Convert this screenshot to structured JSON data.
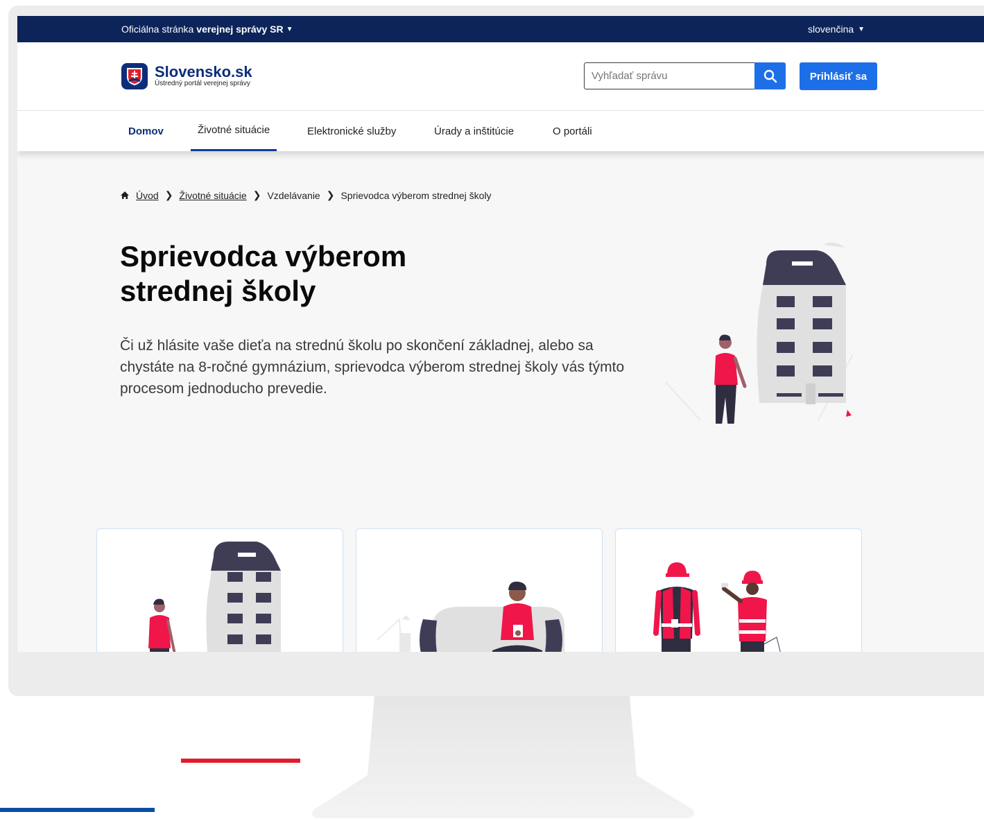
{
  "gov_bar": {
    "official_prefix": "Oficiálna stránka",
    "official_bold": "verejnej správy SR",
    "language": "slovenčina"
  },
  "header": {
    "logo_title": "Slovensko.sk",
    "logo_subtitle": "Ústredný portál verejnej správy",
    "search_placeholder": "Vyhľadať správu",
    "login_label": "Prihlásiť sa"
  },
  "nav": {
    "items": [
      {
        "label": "Domov"
      },
      {
        "label": "Životné situácie"
      },
      {
        "label": "Elektronické služby"
      },
      {
        "label": "Úrady a inštitúcie"
      },
      {
        "label": "O portáli"
      }
    ]
  },
  "breadcrumb": {
    "items": [
      {
        "label": "Úvod"
      },
      {
        "label": "Životné situácie"
      },
      {
        "label": "Vzdelávanie"
      },
      {
        "label": "Sprievodca výberom strednej školy"
      }
    ]
  },
  "hero": {
    "title_line1": "Sprievodca výberom",
    "title_line2": "strednej školy",
    "text": "Či už hlásite vaše dieťa na strednú školu po skončení základnej, alebo sa chystáte na 8-ročné gymnázium, sprievodca výberom strednej školy vás týmto procesom jednoducho prevedie."
  },
  "colors": {
    "gov_bar": "#0c2459",
    "brand_blue": "#1d6fe8",
    "accent_red": "#f0164a"
  }
}
